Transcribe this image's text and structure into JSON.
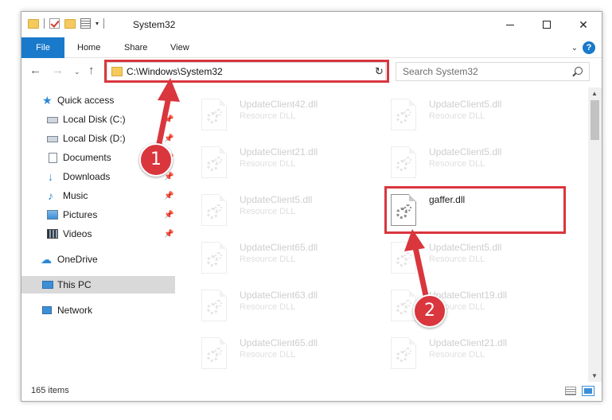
{
  "window": {
    "title": "System32",
    "controls": {
      "minimize": "minimize-icon",
      "maximize": "maximize-icon",
      "close": "close-icon"
    }
  },
  "ribbon": {
    "tabs": [
      "File",
      "Home",
      "Share",
      "View"
    ],
    "help": "?"
  },
  "navigation": {
    "address": "C:\\Windows\\System32",
    "search_placeholder": "Search System32"
  },
  "sidebar": {
    "items": [
      {
        "label": "Quick access",
        "icon": "star-icon",
        "pinned": false
      },
      {
        "label": "Local Disk (C:)",
        "icon": "disk-icon",
        "pinned": true
      },
      {
        "label": "Local Disk (D:)",
        "icon": "disk-icon",
        "pinned": true
      },
      {
        "label": "Documents",
        "icon": "documents-icon",
        "pinned": true
      },
      {
        "label": "Downloads",
        "icon": "download-icon",
        "pinned": true
      },
      {
        "label": "Music",
        "icon": "music-icon",
        "pinned": true
      },
      {
        "label": "Pictures",
        "icon": "pictures-icon",
        "pinned": true
      },
      {
        "label": "Videos",
        "icon": "videos-icon",
        "pinned": true
      },
      {
        "label": "OneDrive",
        "icon": "cloud-icon",
        "pinned": false
      },
      {
        "label": "This PC",
        "icon": "computer-icon",
        "pinned": false,
        "selected": true
      },
      {
        "label": "Network",
        "icon": "network-icon",
        "pinned": false
      }
    ]
  },
  "files": {
    "left": [
      {
        "name": "UpdateClient42.dll",
        "type": "Resource DLL"
      },
      {
        "name": "UpdateClient21.dll",
        "type": "Resource DLL"
      },
      {
        "name": "UpdateClient5.dll",
        "type": "Resource DLL"
      },
      {
        "name": "UpdateClient65.dll",
        "type": "Resource DLL"
      },
      {
        "name": "UpdateClient63.dll",
        "type": "Resource DLL"
      },
      {
        "name": "UpdateClient65.dll",
        "type": "Resource DLL"
      }
    ],
    "right": [
      {
        "name": "UpdateClient5.dll",
        "type": "Resource DLL"
      },
      {
        "name": "UpdateClient5.dll",
        "type": "Resource DLL"
      },
      {
        "name": "gaffer.dll",
        "type": "",
        "highlighted": true
      },
      {
        "name": "UpdateClient5.dll",
        "type": "Resource DLL"
      },
      {
        "name": "UpdateClient19.dll",
        "type": "Resource DLL"
      },
      {
        "name": "UpdateClient21.dll",
        "type": "Resource DLL"
      }
    ]
  },
  "status": {
    "item_count": "165 items"
  },
  "annotations": {
    "step1": "1",
    "step2": "2",
    "accent_color": "#d9363e"
  }
}
